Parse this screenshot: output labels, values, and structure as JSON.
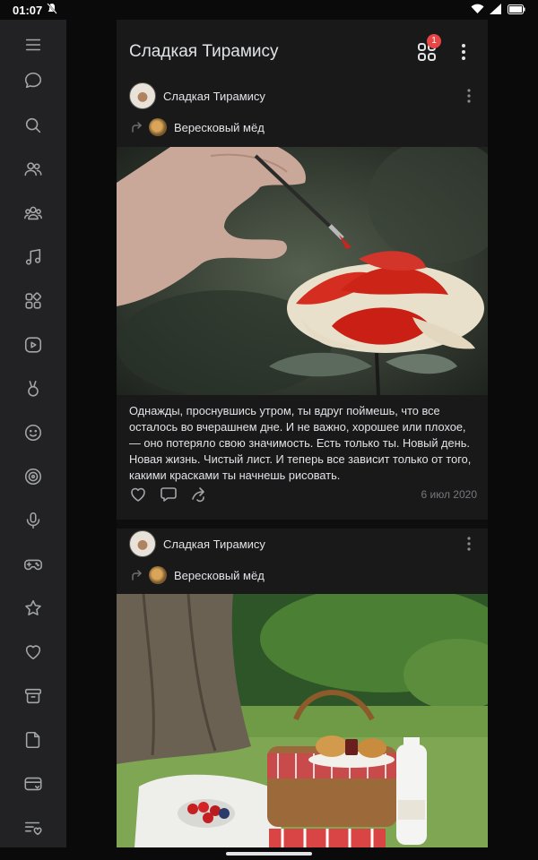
{
  "status": {
    "time": "01:07"
  },
  "header": {
    "title": "Сладкая Тирамису",
    "badge": "1"
  },
  "sidebar": {
    "items": [
      "menu-icon",
      "messages-icon",
      "search-icon",
      "friends-icon",
      "communities-icon",
      "music-icon",
      "services-icon",
      "video-icon",
      "clips-icon",
      "stickers-icon",
      "target-icon",
      "podcasts-icon",
      "games-icon",
      "favorites-icon",
      "likes-icon",
      "archive-icon",
      "documents-icon",
      "payments-icon",
      "lists-icon"
    ]
  },
  "posts": [
    {
      "author": "Сладкая Тирамису",
      "repost_from": "Вересковый мёд",
      "text": "Однажды, проснувшись утром, ты вдруг поймешь, что все осталось во вчерашнем дне. И не важно, хорошее или плохое, — оно потеряло свою значимость. Есть только ты. Новый день. Новая жизнь. Чистый лист. И теперь все зависит только от того, какими красками ты начнешь рисовать.",
      "date": "6 июл 2020"
    },
    {
      "author": "Сладкая Тирамису",
      "repost_from": "Вересковый мёд"
    }
  ]
}
